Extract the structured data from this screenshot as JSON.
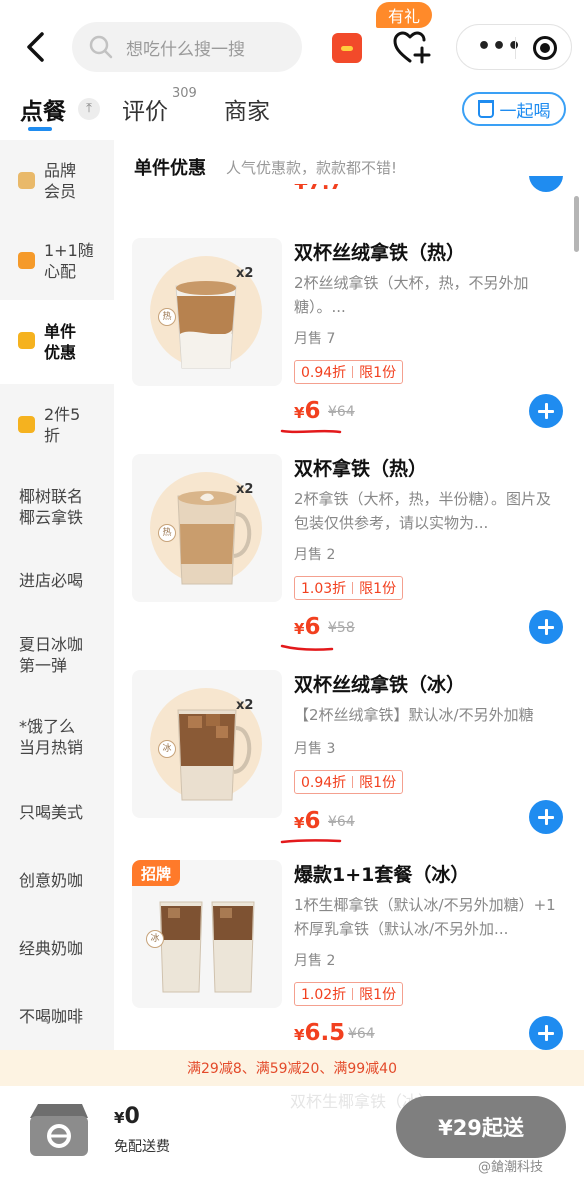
{
  "header": {
    "search_placeholder": "想吃什么搜一搜",
    "gift_badge": "有礼"
  },
  "tabs": {
    "order": "点餐",
    "review": "评价",
    "review_count": "309",
    "shop": "商家",
    "drink_together": "一起喝"
  },
  "sidebar": {
    "items": [
      {
        "label": "品牌\n会员",
        "icon_color": "#e9b96a"
      },
      {
        "label": "1+1随\n心配",
        "icon_color": "#f59a2a"
      },
      {
        "label": "单件\n优惠",
        "icon_color": "#f5b21f"
      },
      {
        "label": "2件5\n折",
        "icon_color": "#f5b21f"
      },
      {
        "label": "椰树联名\n椰云拿铁"
      },
      {
        "label": "进店必喝"
      },
      {
        "label": "夏日冰咖\n第一弹"
      },
      {
        "label": "*饿了么\n当月热销"
      },
      {
        "label": "只喝美式"
      },
      {
        "label": "创意奶咖"
      },
      {
        "label": "经典奶咖"
      },
      {
        "label": "不喝咖啡"
      }
    ]
  },
  "section": {
    "title": "单件优惠",
    "subtitle": "人气优惠款，款款都不错!"
  },
  "products": [
    {
      "name": "双杯丝绒拿铁（热）",
      "desc": "2杯丝绒拿铁（大杯，热，不另外加糖）。...",
      "sold": "月售 7",
      "discount": "0.94折",
      "limit": "限1份",
      "yen": "¥",
      "price": "6",
      "orig": "¥64",
      "qty": "x2",
      "stamp": "热"
    },
    {
      "name": "双杯拿铁（热）",
      "desc": "2杯拿铁（大杯，热，半份糖）。图片及包装仅供参考，请以实物为...",
      "sold": "月售 2",
      "discount": "1.03折",
      "limit": "限1份",
      "yen": "¥",
      "price": "6",
      "orig": "¥58",
      "qty": "x2",
      "stamp": "热"
    },
    {
      "name": "双杯丝绒拿铁（冰）",
      "desc": "【2杯丝绒拿铁】默认冰/不另外加糖",
      "sold": "月售 3",
      "discount": "0.94折",
      "limit": "限1份",
      "yen": "¥",
      "price": "6",
      "orig": "¥64",
      "qty": "x2",
      "stamp": "冰"
    },
    {
      "name": "爆款1+1套餐（冰）",
      "desc": "1杯生椰拿铁（默认冰/不另外加糖）+1杯厚乳拿铁（默认冰/不另外加...",
      "sold": "月售 2",
      "discount": "1.02折",
      "limit": "限1份",
      "yen": "¥",
      "price": "6.5",
      "orig": "¥64",
      "badge": "招牌",
      "stamp": "冰"
    }
  ],
  "promo": "满29减8、满59减20、满99减40",
  "cart": {
    "yen": "¥",
    "total": "0",
    "fee": "免配送费",
    "checkout": "¥29起送"
  },
  "ghost_text": "双杯生椰拿铁（冰）",
  "watermark": "@鎗潮科技",
  "colors": {
    "accent": "#1f8cf0",
    "price": "#f2401f",
    "promo_bg": "#fdf3e2",
    "checkout_bg": "#7f7f7f"
  }
}
